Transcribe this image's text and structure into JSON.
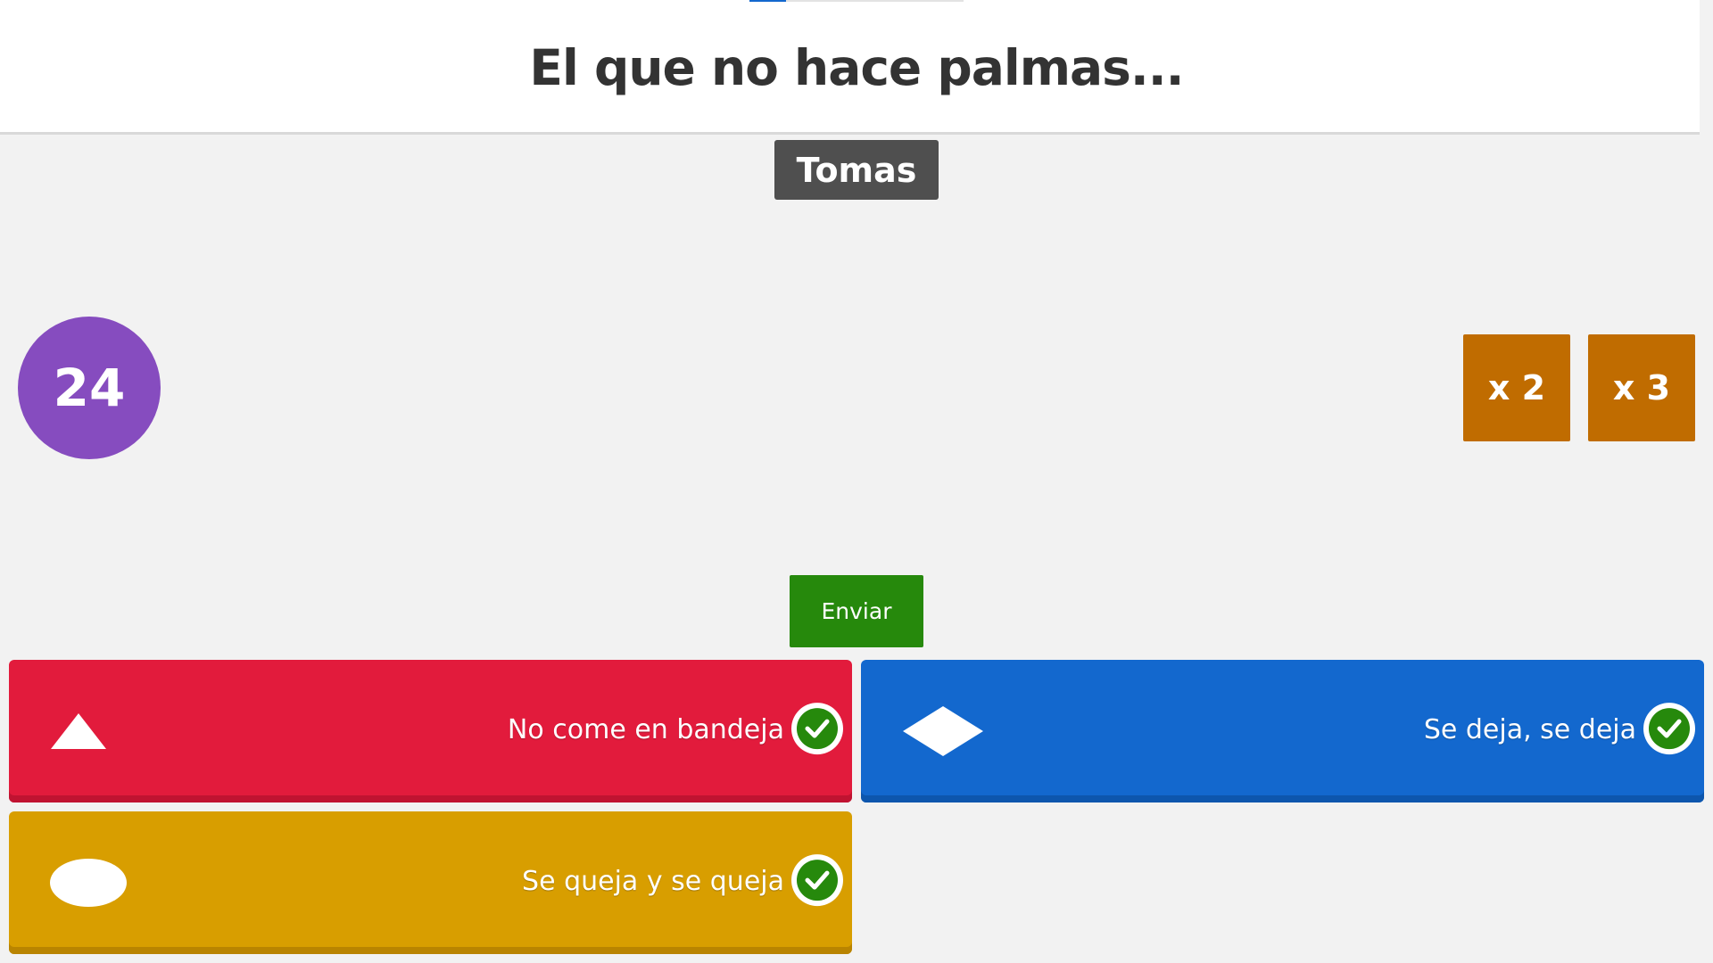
{
  "question": {
    "title": "El que no hace palmas..."
  },
  "progress": {
    "fraction": 0.17
  },
  "player": {
    "name": "Tomas"
  },
  "timer": {
    "value": "24"
  },
  "multipliers": [
    {
      "label": "x 2"
    },
    {
      "label": "x 3"
    }
  ],
  "submit": {
    "label": "Enviar"
  },
  "answers": [
    {
      "text": "No come en bandeja",
      "shape": "triangle-icon",
      "color": "#e21b3c",
      "selected": true
    },
    {
      "text": "Se deja, se deja",
      "shape": "diamond-icon",
      "color": "#1368ce",
      "selected": true
    },
    {
      "text": "Se queja y se queja",
      "shape": "circle-icon",
      "color": "#d89e00",
      "selected": true
    }
  ],
  "colors": {
    "timer": "#864cbf",
    "multiplier": "#c06c00",
    "submit": "#26890c",
    "check": "#26890c"
  }
}
